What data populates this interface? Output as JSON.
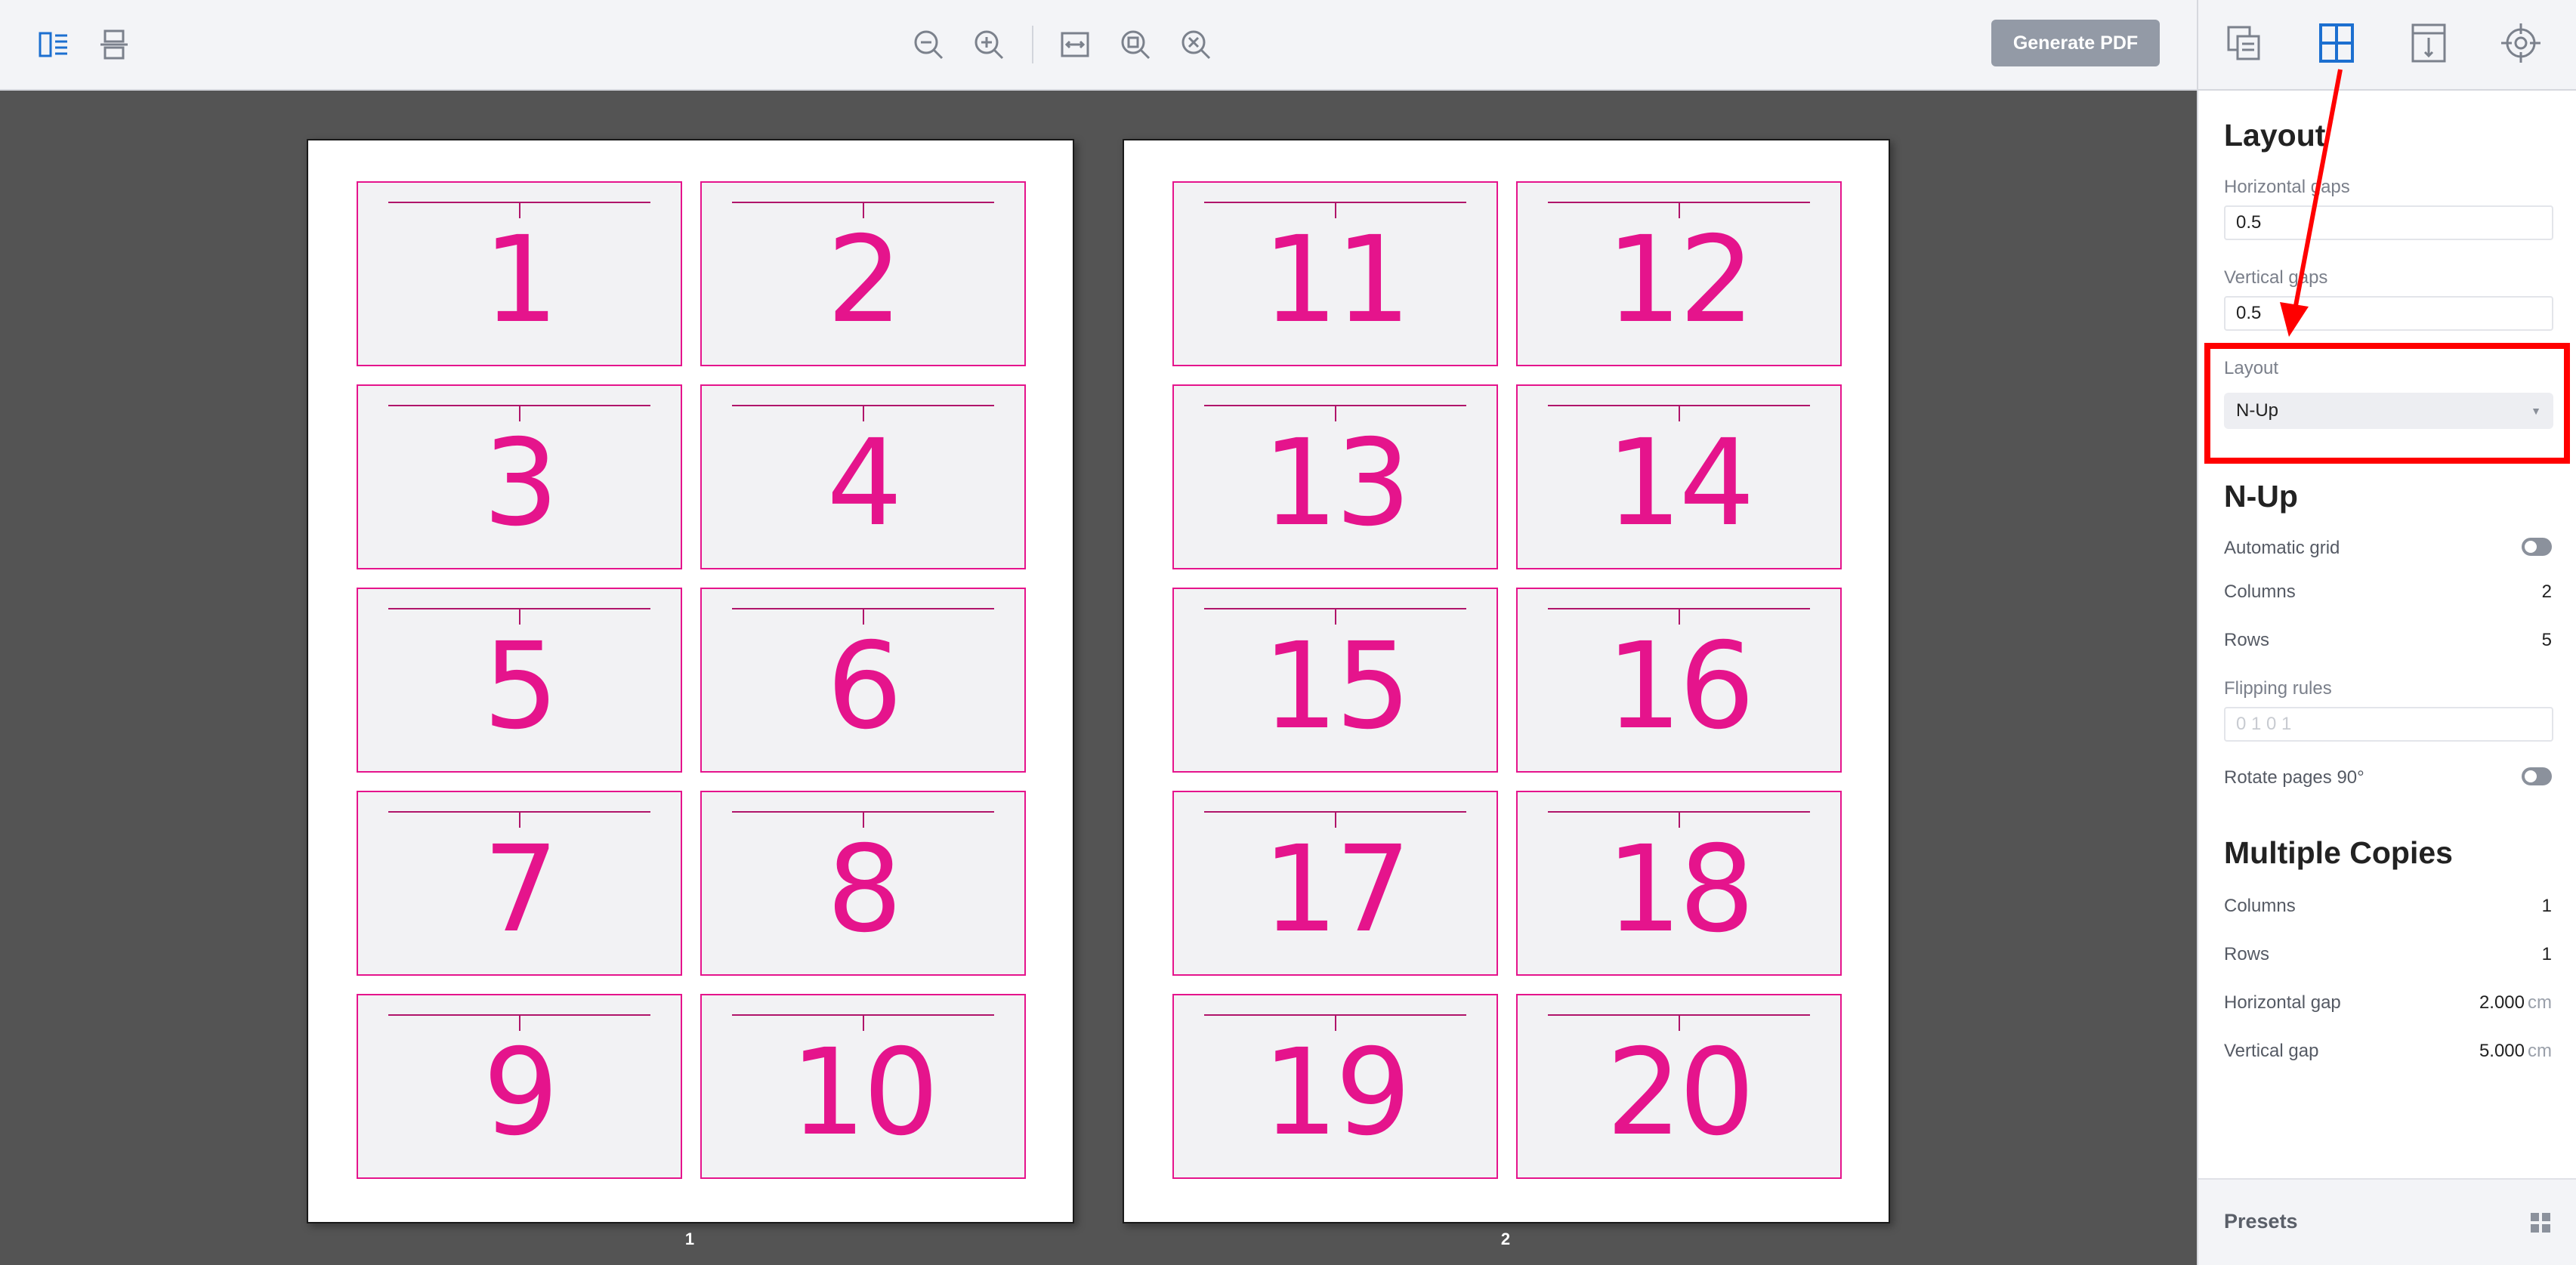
{
  "toolbar": {
    "left_icons": [
      "single-page-view-icon",
      "continuous-scroll-view-icon"
    ],
    "zoom_icons": [
      "zoom-out-icon",
      "zoom-in-icon"
    ],
    "fit_icons": [
      "fit-width-icon",
      "fit-page-icon",
      "actual-size-icon"
    ],
    "generate_label": "Generate PDF"
  },
  "pages": [
    {
      "number": "1",
      "cards": [
        "1",
        "2",
        "3",
        "4",
        "5",
        "6",
        "7",
        "8",
        "9",
        "10"
      ]
    },
    {
      "number": "2",
      "cards": [
        "11",
        "12",
        "13",
        "14",
        "15",
        "16",
        "17",
        "18",
        "19",
        "20"
      ]
    }
  ],
  "panel": {
    "tabs": [
      {
        "icon": "documents-tab-icon",
        "active": false
      },
      {
        "icon": "layout-tab-icon",
        "active": true
      },
      {
        "icon": "marks-tab-icon",
        "active": false
      },
      {
        "icon": "crop-marks-tab-icon",
        "active": false
      }
    ],
    "layout": {
      "title": "Layout",
      "horizontal_gaps_label": "Horizontal gaps",
      "horizontal_gaps_value": "0.5",
      "vertical_gaps_label": "Vertical gaps",
      "vertical_gaps_value": "0.5",
      "layout_label": "Layout",
      "layout_value": "N-Up"
    },
    "nup": {
      "title": "N-Up",
      "automatic_grid_label": "Automatic grid",
      "automatic_grid_on": false,
      "columns_label": "Columns",
      "columns_value": "2",
      "rows_label": "Rows",
      "rows_value": "5",
      "flipping_rules_label": "Flipping rules",
      "flipping_rules_placeholder": "0 1 0 1",
      "rotate_label": "Rotate pages 90°",
      "rotate_on": false
    },
    "copies": {
      "title": "Multiple Copies",
      "columns_label": "Columns",
      "columns_value": "1",
      "rows_label": "Rows",
      "rows_value": "1",
      "hgap_label": "Horizontal gap",
      "hgap_value": "2.000",
      "hgap_unit": "cm",
      "vgap_label": "Vertical gap",
      "vgap_value": "5.000",
      "vgap_unit": "cm"
    },
    "presets_label": "Presets"
  },
  "colors": {
    "card_accent": "#e5148c",
    "active_tab": "#1c6fd0",
    "annotation": "#ff0000",
    "canvas_bg": "#545454"
  }
}
